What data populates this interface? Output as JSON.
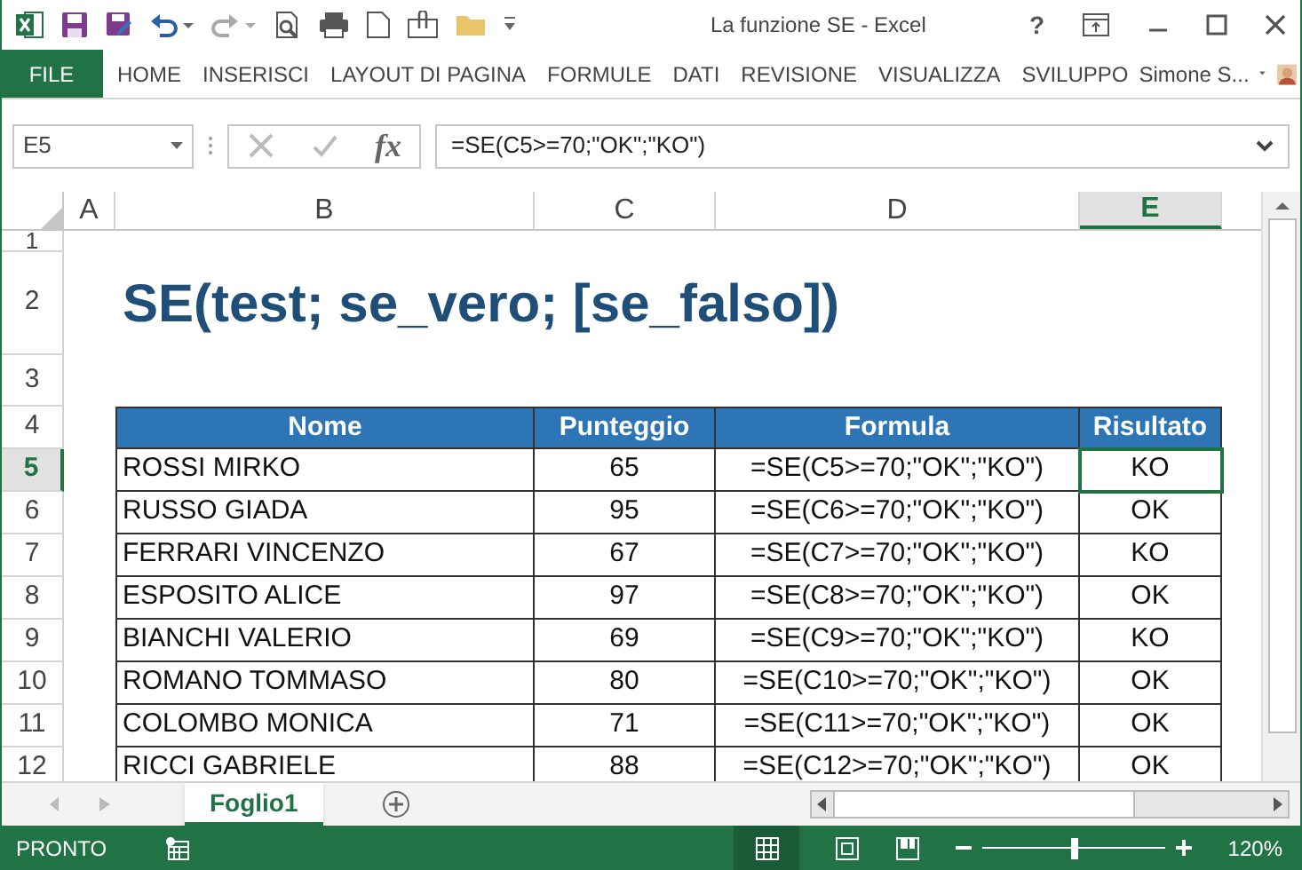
{
  "title_bar": {
    "title": "La funzione SE - Excel",
    "help": "?",
    "user_name": "Simone S..."
  },
  "ribbon": {
    "file_tab": "FILE",
    "tabs": [
      {
        "label": "HOME",
        "selected": false
      },
      {
        "label": "INSERISCI",
        "selected": false
      },
      {
        "label": "LAYOUT DI PAGINA",
        "selected": false
      },
      {
        "label": "FORMULE",
        "selected": false
      },
      {
        "label": "DATI",
        "selected": false
      },
      {
        "label": "REVISIONE",
        "selected": false
      },
      {
        "label": "VISUALIZZA",
        "selected": false
      },
      {
        "label": "SVILUPPO",
        "selected": false
      }
    ]
  },
  "formula_bar": {
    "name_box": "E5",
    "fx": "fx",
    "formula": "=SE(C5>=70;\"OK\";\"KO\")"
  },
  "columns": [
    {
      "label": "A",
      "selected": false
    },
    {
      "label": "B",
      "selected": false
    },
    {
      "label": "C",
      "selected": false
    },
    {
      "label": "D",
      "selected": false
    },
    {
      "label": "E",
      "selected": true
    }
  ],
  "row_headers": [
    {
      "label": "1",
      "selected": false
    },
    {
      "label": "2",
      "selected": false
    },
    {
      "label": "3",
      "selected": false
    },
    {
      "label": "4",
      "selected": false
    },
    {
      "label": "5",
      "selected": true
    },
    {
      "label": "6",
      "selected": false
    },
    {
      "label": "7",
      "selected": false
    },
    {
      "label": "8",
      "selected": false
    },
    {
      "label": "9",
      "selected": false
    },
    {
      "label": "10",
      "selected": false
    },
    {
      "label": "11",
      "selected": false
    },
    {
      "label": "12",
      "selected": false
    }
  ],
  "heading": "SE(test; se_vero; [se_falso])",
  "table": {
    "columns": [
      "Nome",
      "Punteggio",
      "Formula",
      "Risultato"
    ],
    "rows": [
      {
        "name": "ROSSI MIRKO",
        "score": "65",
        "formula": "=SE(C5>=70;\"OK\";\"KO\")",
        "result": "KO",
        "selected": true
      },
      {
        "name": "RUSSO GIADA",
        "score": "95",
        "formula": "=SE(C6>=70;\"OK\";\"KO\")",
        "result": "OK",
        "selected": false
      },
      {
        "name": "FERRARI VINCENZO",
        "score": "67",
        "formula": "=SE(C7>=70;\"OK\";\"KO\")",
        "result": "KO",
        "selected": false
      },
      {
        "name": "ESPOSITO ALICE",
        "score": "97",
        "formula": "=SE(C8>=70;\"OK\";\"KO\")",
        "result": "OK",
        "selected": false
      },
      {
        "name": "BIANCHI VALERIO",
        "score": "69",
        "formula": "=SE(C9>=70;\"OK\";\"KO\")",
        "result": "KO",
        "selected": false
      },
      {
        "name": "ROMANO TOMMASO",
        "score": "80",
        "formula": "=SE(C10>=70;\"OK\";\"KO\")",
        "result": "OK",
        "selected": false
      },
      {
        "name": "COLOMBO MONICA",
        "score": "71",
        "formula": "=SE(C11>=70;\"OK\";\"KO\")",
        "result": "OK",
        "selected": false
      },
      {
        "name": "RICCI GABRIELE",
        "score": "88",
        "formula": "=SE(C12>=70;\"OK\";\"KO\")",
        "result": "OK",
        "selected": false
      }
    ]
  },
  "sheet_tabs": [
    {
      "label": "Foglio1",
      "selected": true
    }
  ],
  "status_bar": {
    "status": "PRONTO",
    "zoom": {
      "level": 0.5,
      "reading": "120%"
    }
  }
}
